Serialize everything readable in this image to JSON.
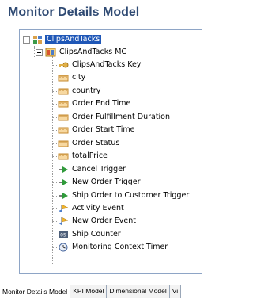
{
  "title": "Monitor Details Model",
  "tree": {
    "root": {
      "label": "ClipsAndTacks",
      "icon": "model-root-icon"
    },
    "mc": {
      "label": "ClipsAndTacks MC",
      "icon": "monitoring-context-icon"
    },
    "items": [
      {
        "label": "ClipsAndTacks Key",
        "icon": "key-icon"
      },
      {
        "label": "city",
        "icon": "metric-icon"
      },
      {
        "label": "country",
        "icon": "metric-icon"
      },
      {
        "label": "Order End Time",
        "icon": "metric-icon"
      },
      {
        "label": "Order Fulfillment Duration",
        "icon": "metric-icon"
      },
      {
        "label": "Order Start Time",
        "icon": "metric-icon"
      },
      {
        "label": "Order Status",
        "icon": "metric-icon"
      },
      {
        "label": "totalPrice",
        "icon": "metric-icon"
      },
      {
        "label": "Cancel Trigger",
        "icon": "trigger-icon"
      },
      {
        "label": "New Order Trigger",
        "icon": "trigger-icon"
      },
      {
        "label": "Ship Order to Customer Trigger",
        "icon": "trigger-icon"
      },
      {
        "label": "Activity Event",
        "icon": "event-icon"
      },
      {
        "label": "New Order Event",
        "icon": "event-icon"
      },
      {
        "label": "Ship Counter",
        "icon": "counter-icon"
      },
      {
        "label": "Monitoring Context Timer",
        "icon": "timer-icon"
      }
    ]
  },
  "tabs": [
    {
      "label": "Monitor Details Model",
      "active": true
    },
    {
      "label": "KPI Model",
      "active": false
    },
    {
      "label": "Dimensional Model",
      "active": false
    },
    {
      "label": "Vi",
      "active": false
    }
  ],
  "colors": {
    "title": "#2f4a73",
    "selection": "#1f57b7",
    "metric": "#d9a14a",
    "trigger": "#2f9a3a",
    "event": "#f0b32a",
    "counter": "#4d5f7a",
    "key": "#e0b048"
  }
}
